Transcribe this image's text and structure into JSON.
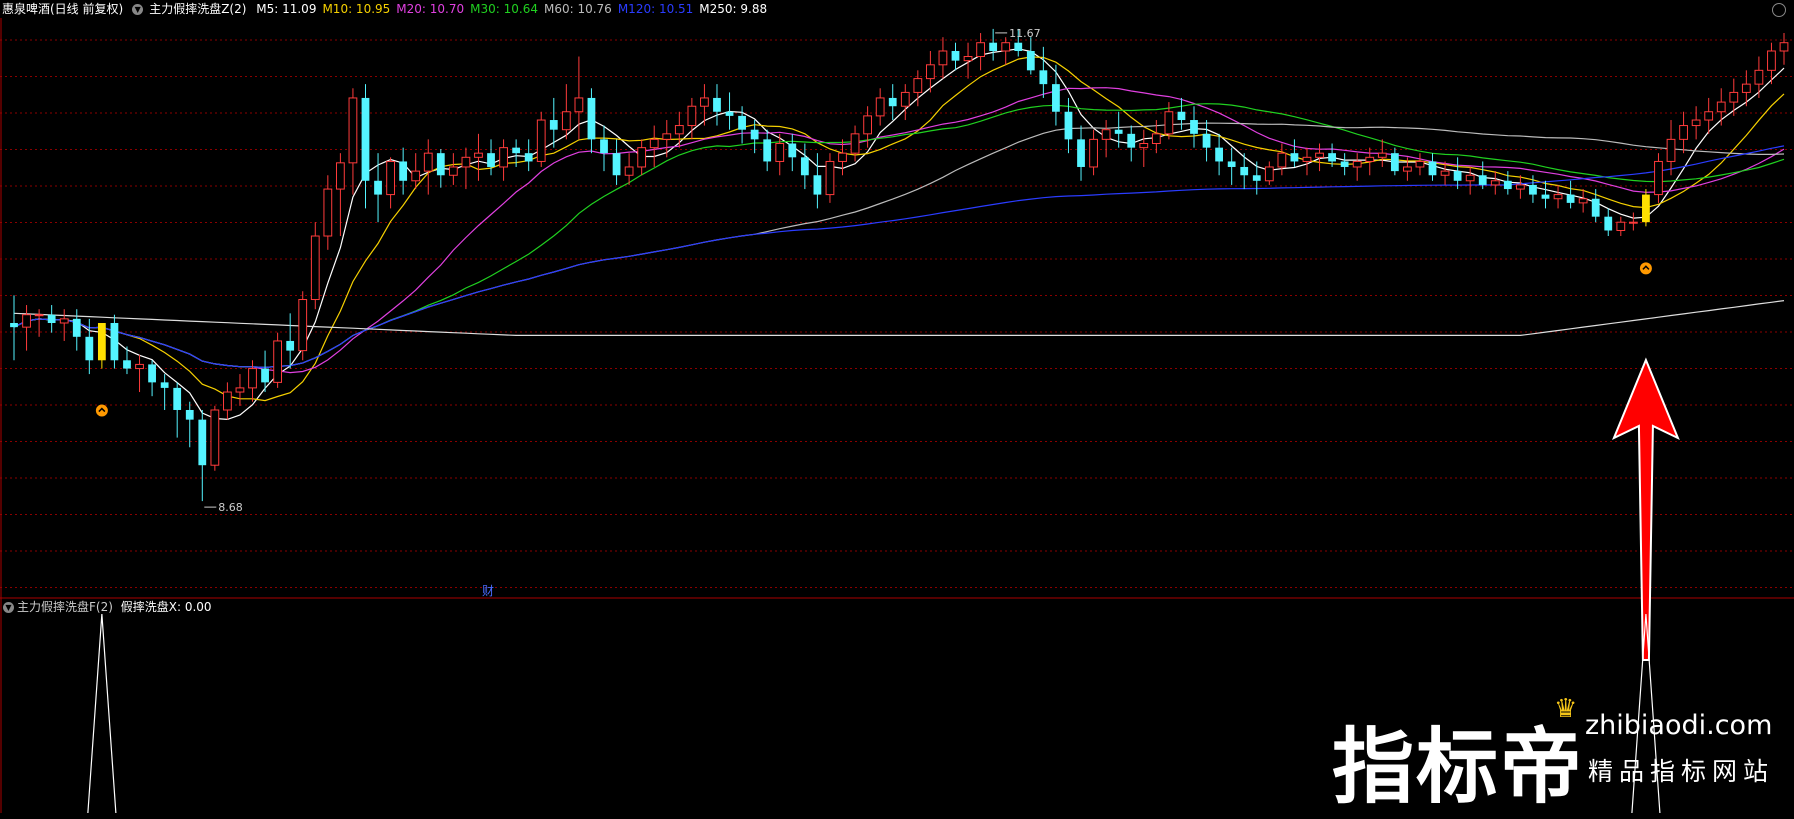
{
  "header": {
    "stock_name": "惠泉啤酒(日线 前复权)",
    "indicator_name": "主力假摔洗盘Z(2)",
    "ma": [
      {
        "label": "M5: 11.09",
        "color": "#ffffff"
      },
      {
        "label": "M10: 10.95",
        "color": "#f5d000"
      },
      {
        "label": "M20: 10.70",
        "color": "#e040e0"
      },
      {
        "label": "M30: 10.64",
        "color": "#20d020"
      },
      {
        "label": "M60: 10.76",
        "color": "#bbbbbb"
      },
      {
        "label": "M120: 10.51",
        "color": "#2a3cff"
      },
      {
        "label": "M250: 9.88",
        "color": "#ffffff"
      }
    ]
  },
  "sub_header": {
    "indicator_name": "主力假摔洗盘F(2)",
    "value_label": "假摔洗盘X: 0.00"
  },
  "annotations": {
    "high_label": "11.67",
    "low_label": "8.68",
    "cai_marker": "财"
  },
  "watermark": {
    "brand": "指标帝",
    "site": "zhibiaodi.com",
    "tagline": "精品指标网站"
  },
  "colors": {
    "up": "#ff3b3b",
    "down": "#54f4ff",
    "signal": "#ffe000",
    "grid": "#8b0000",
    "arrow": "#ff0000"
  },
  "chart_data": {
    "type": "candlestick",
    "price_range": [
      8.0,
      12.15
    ],
    "signal_days": [
      7,
      130
    ],
    "candles": [
      [
        9.97,
        10.17,
        9.7,
        9.94
      ],
      [
        9.94,
        10.1,
        9.77,
        10.03
      ],
      [
        10.03,
        10.07,
        9.87,
        10.03
      ],
      [
        10.03,
        10.1,
        9.9,
        9.97
      ],
      [
        9.97,
        10.07,
        9.84,
        10.0
      ],
      [
        10.0,
        10.07,
        9.77,
        9.87
      ],
      [
        9.87,
        10.0,
        9.6,
        9.7
      ],
      [
        9.7,
        9.97,
        9.64,
        9.97
      ],
      [
        9.97,
        10.03,
        9.64,
        9.7
      ],
      [
        9.7,
        9.8,
        9.6,
        9.64
      ],
      [
        9.64,
        9.74,
        9.47,
        9.67
      ],
      [
        9.67,
        9.7,
        9.44,
        9.54
      ],
      [
        9.54,
        9.6,
        9.34,
        9.5
      ],
      [
        9.5,
        9.54,
        9.14,
        9.34
      ],
      [
        9.34,
        9.4,
        9.07,
        9.27
      ],
      [
        9.27,
        9.34,
        8.68,
        8.94
      ],
      [
        8.94,
        9.37,
        8.9,
        9.34
      ],
      [
        9.34,
        9.54,
        9.27,
        9.47
      ],
      [
        9.47,
        9.6,
        9.37,
        9.5
      ],
      [
        9.5,
        9.7,
        9.4,
        9.64
      ],
      [
        9.64,
        9.77,
        9.47,
        9.54
      ],
      [
        9.54,
        9.9,
        9.5,
        9.84
      ],
      [
        9.84,
        10.04,
        9.64,
        9.77
      ],
      [
        9.77,
        10.2,
        9.7,
        10.14
      ],
      [
        10.14,
        10.7,
        10.07,
        10.6
      ],
      [
        10.6,
        11.04,
        10.5,
        10.94
      ],
      [
        10.94,
        11.2,
        10.6,
        11.13
      ],
      [
        11.13,
        11.67,
        10.9,
        11.6
      ],
      [
        11.6,
        11.7,
        10.8,
        11.0
      ],
      [
        11.0,
        11.2,
        10.7,
        10.9
      ],
      [
        10.9,
        11.17,
        10.8,
        11.14
      ],
      [
        11.14,
        11.24,
        10.9,
        11.0
      ],
      [
        11.0,
        11.2,
        10.94,
        11.07
      ],
      [
        11.07,
        11.3,
        10.9,
        11.2
      ],
      [
        11.2,
        11.23,
        10.95,
        11.04
      ],
      [
        11.04,
        11.2,
        10.97,
        11.1
      ],
      [
        11.1,
        11.24,
        10.94,
        11.17
      ],
      [
        11.17,
        11.34,
        11.0,
        11.2
      ],
      [
        11.2,
        11.3,
        11.04,
        11.1
      ],
      [
        11.1,
        11.3,
        11.0,
        11.24
      ],
      [
        11.24,
        11.3,
        11.1,
        11.2
      ],
      [
        11.2,
        11.3,
        11.07,
        11.14
      ],
      [
        11.14,
        11.5,
        11.1,
        11.44
      ],
      [
        11.44,
        11.6,
        11.24,
        11.37
      ],
      [
        11.37,
        11.7,
        11.3,
        11.5
      ],
      [
        11.5,
        11.9,
        11.3,
        11.6
      ],
      [
        11.6,
        11.67,
        11.2,
        11.3
      ],
      [
        11.3,
        11.4,
        11.07,
        11.2
      ],
      [
        11.2,
        11.3,
        10.97,
        11.04
      ],
      [
        11.04,
        11.2,
        10.97,
        11.1
      ],
      [
        11.1,
        11.3,
        11.04,
        11.24
      ],
      [
        11.24,
        11.4,
        11.1,
        11.3
      ],
      [
        11.3,
        11.44,
        11.17,
        11.34
      ],
      [
        11.34,
        11.5,
        11.24,
        11.4
      ],
      [
        11.4,
        11.6,
        11.3,
        11.54
      ],
      [
        11.54,
        11.7,
        11.4,
        11.6
      ],
      [
        11.6,
        11.7,
        11.4,
        11.5
      ],
      [
        11.5,
        11.64,
        11.37,
        11.47
      ],
      [
        11.47,
        11.54,
        11.27,
        11.37
      ],
      [
        11.37,
        11.44,
        11.2,
        11.3
      ],
      [
        11.3,
        11.37,
        11.07,
        11.14
      ],
      [
        11.14,
        11.34,
        11.04,
        11.27
      ],
      [
        11.27,
        11.34,
        11.07,
        11.17
      ],
      [
        11.17,
        11.27,
        10.94,
        11.04
      ],
      [
        11.04,
        11.2,
        10.8,
        10.9
      ],
      [
        10.9,
        11.2,
        10.84,
        11.14
      ],
      [
        11.14,
        11.3,
        11.04,
        11.2
      ],
      [
        11.2,
        11.4,
        11.14,
        11.34
      ],
      [
        11.34,
        11.54,
        11.24,
        11.47
      ],
      [
        11.47,
        11.67,
        11.4,
        11.6
      ],
      [
        11.6,
        11.7,
        11.44,
        11.54
      ],
      [
        11.54,
        11.7,
        11.44,
        11.64
      ],
      [
        11.64,
        11.8,
        11.54,
        11.74
      ],
      [
        11.74,
        11.94,
        11.64,
        11.84
      ],
      [
        11.84,
        12.04,
        11.74,
        11.94
      ],
      [
        11.94,
        12.0,
        11.8,
        11.87
      ],
      [
        11.87,
        12.0,
        11.74,
        11.9
      ],
      [
        11.9,
        12.07,
        11.8,
        12.0
      ],
      [
        12.0,
        12.1,
        11.87,
        11.94
      ],
      [
        11.94,
        12.04,
        11.84,
        12.0
      ],
      [
        12.0,
        12.1,
        11.9,
        11.94
      ],
      [
        11.94,
        12.04,
        11.77,
        11.8
      ],
      [
        11.8,
        11.97,
        11.6,
        11.7
      ],
      [
        11.7,
        11.84,
        11.4,
        11.5
      ],
      [
        11.5,
        11.6,
        11.2,
        11.3
      ],
      [
        11.3,
        11.4,
        11.0,
        11.1
      ],
      [
        11.1,
        11.37,
        11.04,
        11.3
      ],
      [
        11.3,
        11.44,
        11.17,
        11.37
      ],
      [
        11.37,
        11.5,
        11.24,
        11.34
      ],
      [
        11.34,
        11.4,
        11.14,
        11.24
      ],
      [
        11.24,
        11.37,
        11.1,
        11.27
      ],
      [
        11.27,
        11.44,
        11.2,
        11.34
      ],
      [
        11.34,
        11.57,
        11.3,
        11.5
      ],
      [
        11.5,
        11.6,
        11.37,
        11.44
      ],
      [
        11.44,
        11.54,
        11.24,
        11.34
      ],
      [
        11.34,
        11.44,
        11.14,
        11.24
      ],
      [
        11.24,
        11.34,
        11.04,
        11.14
      ],
      [
        11.14,
        11.24,
        10.97,
        11.1
      ],
      [
        11.1,
        11.2,
        10.94,
        11.04
      ],
      [
        11.04,
        11.14,
        10.9,
        11.0
      ],
      [
        11.0,
        11.14,
        10.97,
        11.1
      ],
      [
        11.1,
        11.27,
        11.04,
        11.2
      ],
      [
        11.2,
        11.3,
        11.1,
        11.14
      ],
      [
        11.14,
        11.24,
        11.04,
        11.17
      ],
      [
        11.17,
        11.27,
        11.07,
        11.2
      ],
      [
        11.2,
        11.27,
        11.1,
        11.14
      ],
      [
        11.14,
        11.2,
        11.04,
        11.1
      ],
      [
        11.1,
        11.2,
        11.0,
        11.14
      ],
      [
        11.14,
        11.24,
        11.04,
        11.17
      ],
      [
        11.17,
        11.3,
        11.1,
        11.2
      ],
      [
        11.2,
        11.24,
        11.04,
        11.07
      ],
      [
        11.07,
        11.17,
        11.0,
        11.1
      ],
      [
        11.1,
        11.2,
        11.04,
        11.14
      ],
      [
        11.14,
        11.2,
        11.0,
        11.04
      ],
      [
        11.04,
        11.14,
        10.97,
        11.07
      ],
      [
        11.07,
        11.17,
        10.94,
        11.0
      ],
      [
        11.0,
        11.1,
        10.9,
        11.04
      ],
      [
        11.04,
        11.14,
        10.94,
        10.97
      ],
      [
        10.97,
        11.07,
        10.9,
        11.0
      ],
      [
        11.0,
        11.07,
        10.9,
        10.94
      ],
      [
        10.94,
        11.04,
        10.87,
        10.97
      ],
      [
        10.97,
        11.04,
        10.84,
        10.9
      ],
      [
        10.9,
        11.0,
        10.8,
        10.87
      ],
      [
        10.87,
        10.97,
        10.8,
        10.9
      ],
      [
        10.9,
        11.0,
        10.8,
        10.84
      ],
      [
        10.84,
        10.94,
        10.77,
        10.87
      ],
      [
        10.87,
        10.94,
        10.7,
        10.74
      ],
      [
        10.74,
        10.8,
        10.6,
        10.64
      ],
      [
        10.64,
        10.74,
        10.6,
        10.7
      ],
      [
        10.7,
        10.77,
        10.64,
        10.7
      ],
      [
        10.7,
        10.94,
        10.67,
        10.9
      ],
      [
        10.9,
        11.2,
        10.84,
        11.14
      ],
      [
        11.14,
        11.44,
        11.04,
        11.3
      ],
      [
        11.3,
        11.5,
        11.2,
        11.4
      ],
      [
        11.4,
        11.54,
        11.3,
        11.44
      ],
      [
        11.44,
        11.6,
        11.34,
        11.5
      ],
      [
        11.5,
        11.67,
        11.4,
        11.57
      ],
      [
        11.57,
        11.74,
        11.47,
        11.64
      ],
      [
        11.64,
        11.8,
        11.54,
        11.7
      ],
      [
        11.7,
        11.9,
        11.6,
        11.8
      ],
      [
        11.8,
        12.0,
        11.7,
        11.94
      ],
      [
        11.94,
        12.07,
        11.84,
        12.0
      ]
    ]
  }
}
